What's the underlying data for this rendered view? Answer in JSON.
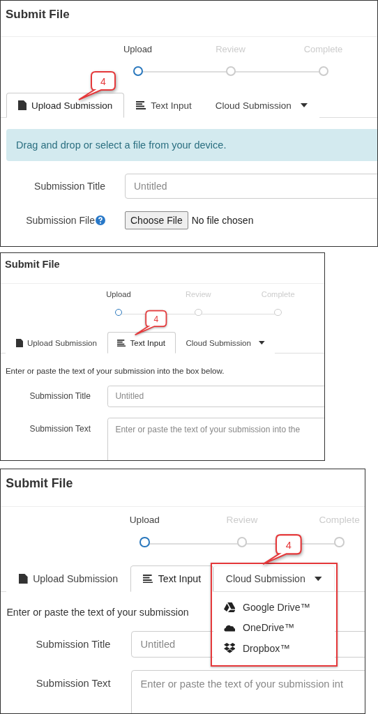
{
  "panels": [
    {
      "title": "Submit File",
      "steps": [
        {
          "label": "Upload",
          "current": true
        },
        {
          "label": "Review",
          "current": false
        },
        {
          "label": "Complete",
          "current": false
        }
      ],
      "tabs": [
        {
          "kind": "file",
          "label": "Upload Submission",
          "selected": true,
          "callout": "4",
          "expanded": false,
          "highlighted": false
        },
        {
          "kind": "text",
          "label": "Text Input",
          "selected": false,
          "expanded": false,
          "highlighted": false
        },
        {
          "kind": "cloud",
          "label": "Cloud Submission",
          "selected": false,
          "expanded": false,
          "highlighted": false
        }
      ],
      "alert": "Drag and drop or select a file from your device.",
      "fields": [
        {
          "kind": "text",
          "label": "Submission Title",
          "placeholder": "Untitled"
        },
        {
          "kind": "file",
          "label": "Submission File",
          "help": true,
          "button": "Choose File",
          "status": "No file chosen"
        }
      ]
    },
    {
      "title": "Submit File",
      "steps": [
        {
          "label": "Upload",
          "current": true
        },
        {
          "label": "Review",
          "current": false
        },
        {
          "label": "Complete",
          "current": false
        }
      ],
      "tabs": [
        {
          "kind": "file",
          "label": "Upload Submission",
          "selected": false,
          "expanded": false,
          "highlighted": false
        },
        {
          "kind": "text",
          "label": "Text Input",
          "selected": true,
          "callout": "4",
          "expanded": false,
          "highlighted": false
        },
        {
          "kind": "cloud",
          "label": "Cloud Submission",
          "selected": false,
          "expanded": false,
          "highlighted": false
        }
      ],
      "intro": "Enter or paste the text of your submission into the box below.",
      "fields": [
        {
          "kind": "text",
          "label": "Submission Title",
          "placeholder": "Untitled"
        },
        {
          "kind": "textarea",
          "label": "Submission Text",
          "placeholder": "Enter or paste the text of your submission into the"
        }
      ]
    },
    {
      "title": "Submit File",
      "steps": [
        {
          "label": "Upload",
          "current": true
        },
        {
          "label": "Review",
          "current": false
        },
        {
          "label": "Complete",
          "current": false
        }
      ],
      "tabs": [
        {
          "kind": "file",
          "label": "Upload Submission",
          "selected": false,
          "expanded": false,
          "highlighted": false
        },
        {
          "kind": "text",
          "label": "Text Input",
          "selected": true,
          "expanded": false,
          "highlighted": false
        },
        {
          "kind": "cloud",
          "label": "Cloud Submission",
          "selected": false,
          "callout": "4",
          "expanded": true,
          "highlighted": true,
          "menu": [
            {
              "kind": "drive",
              "label": "Google Drive™"
            },
            {
              "kind": "onedrive",
              "label": "OneDrive™"
            },
            {
              "kind": "dropbox",
              "label": "Dropbox™"
            }
          ]
        }
      ],
      "intro": "Enter or paste the text of your submission",
      "fields": [
        {
          "kind": "text",
          "label": "Submission Title",
          "placeholder": "Untitled"
        },
        {
          "kind": "textarea",
          "label": "Submission Text",
          "placeholder": "Enter or paste the text of your submission int"
        }
      ]
    }
  ]
}
